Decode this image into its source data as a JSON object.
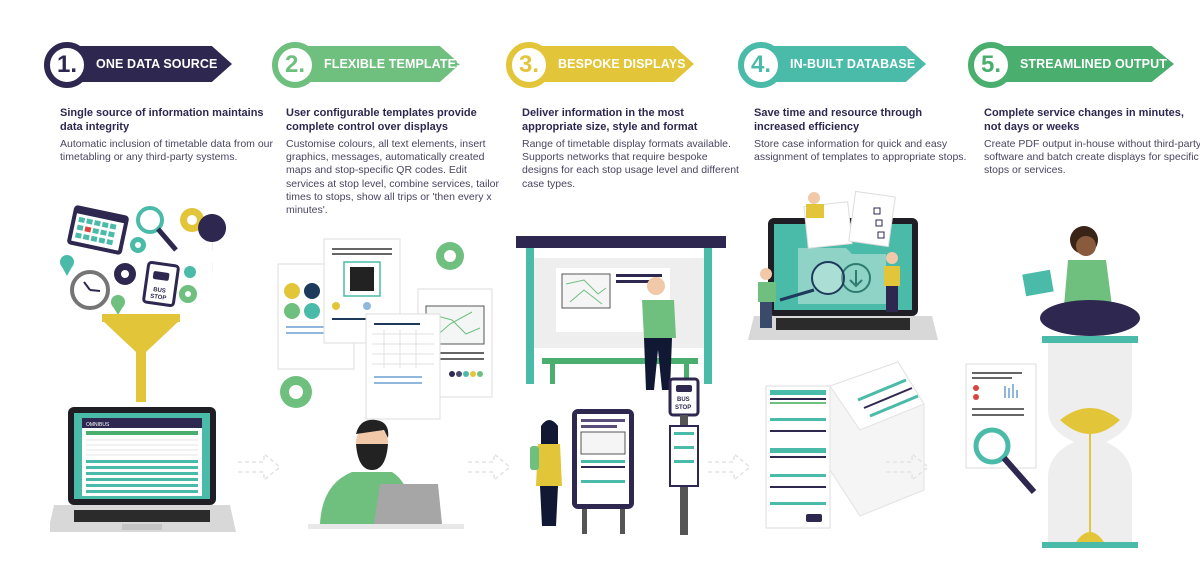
{
  "steps": [
    {
      "number": "1.",
      "title": "ONE DATA SOURCE",
      "color": "#2e2750",
      "heading": "Single source of information maintains data integrity",
      "body": "Automatic inclusion of timetable data from our timetabling or any third-party systems.",
      "illustration": "funnel-into-laptop",
      "laptop_brand": "OMNIBUS",
      "bus_stop_sign": "BUS STOP"
    },
    {
      "number": "2.",
      "title": "FLEXIBLE TEMPLATES",
      "color": "#6fbf7f",
      "heading": "User configurable templates provide complete control over displays",
      "body": "Customise colours, all text elements, insert graphics, messages, automatically created maps and stop-specific QR codes. Edit services at stop level, combine services, tailor times to stops, show all trips or 'then every x minutes'.",
      "illustration": "designer-with-templates"
    },
    {
      "number": "3.",
      "title": "BESPOKE DISPLAYS",
      "color": "#e3c53a",
      "heading": "Deliver information in the most appropriate size, style and format",
      "body": "Range of timetable display formats available. Supports networks that require bespoke designs for each stop usage level and different case types.",
      "illustration": "bus-shelter-displays",
      "bus_stop_sign": "BUS STOP"
    },
    {
      "number": "4.",
      "title": "IN-BUILT DATABASE",
      "color": "#4bbba9",
      "heading": "Save time and resource through increased efficiency",
      "body": "Store case information for quick and easy assignment of templates to appropriate stops.",
      "illustration": "laptop-database-documents"
    },
    {
      "number": "5.",
      "title": "STREAMLINED OUTPUT",
      "color": "#4aae6e",
      "heading": "Complete service changes in minutes, not days or weeks",
      "body": "Create PDF output in-house without third-party software and batch create displays for specific stops or services.",
      "illustration": "person-on-hourglass"
    }
  ],
  "colors": {
    "navy": "#2e2750",
    "green": "#6fbf7f",
    "yellow": "#e3c53a",
    "teal": "#4bbba9",
    "darkgreen": "#4aae6e",
    "text": "#4a4560"
  }
}
